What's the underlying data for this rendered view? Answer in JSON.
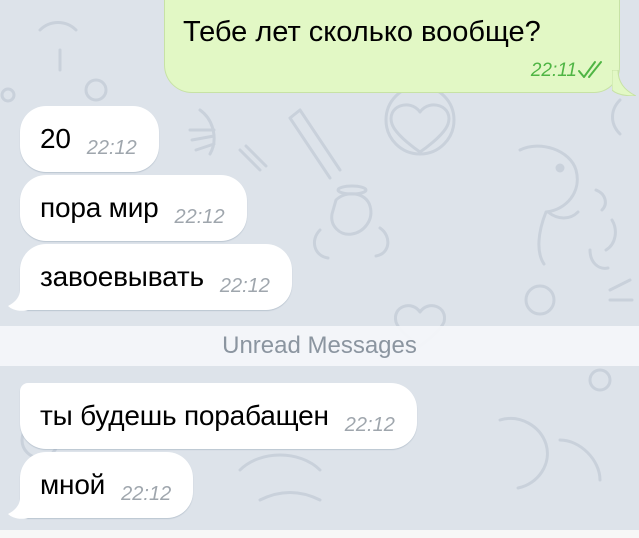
{
  "conversation": {
    "outgoing": {
      "text": "Тебе лет сколько вообще?",
      "time": "22:11",
      "status_icon": "double-check-icon"
    },
    "incoming_before": [
      {
        "text": "20",
        "time": "22:12"
      },
      {
        "text": "пора мир",
        "time": "22:12"
      },
      {
        "text": "завоевывать",
        "time": "22:12"
      }
    ],
    "unread_divider": "Unread Messages",
    "incoming_after": [
      {
        "text": "ты будешь порабащен",
        "time": "22:12"
      },
      {
        "text": "мной",
        "time": "22:12"
      }
    ]
  },
  "colors": {
    "wallpaper": "#dde3ea",
    "outgoing_bubble": "#e2f8c5",
    "incoming_bubble": "#ffffff",
    "outgoing_time": "#4fb544",
    "incoming_time": "#9fa6ad",
    "divider_text": "#8b95a0"
  }
}
